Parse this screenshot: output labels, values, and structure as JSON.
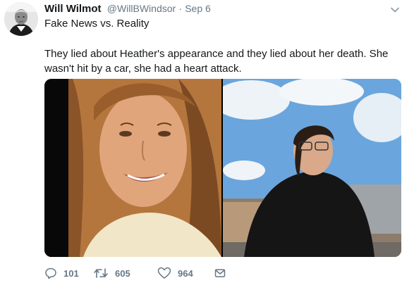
{
  "tweet": {
    "author_name": "Will Wilmot",
    "handle": "@WillBWindsor",
    "separator": "·",
    "time": "Sep 6",
    "line1": "Fake News vs. Reality",
    "text": "They lied about Heather's appearance and they lied about her death. She wasn't hit by a car, she had a heart attack."
  },
  "media": {
    "left_photo": "smiling woman portrait",
    "right_photo": "woman outdoors under cloudy sky"
  },
  "actions": {
    "reply_count": "101",
    "retweet_count": "605",
    "like_count": "964"
  },
  "icons": {
    "caret": "chevron-down-icon",
    "reply": "reply-icon",
    "retweet": "retweet-icon",
    "like": "heart-icon",
    "dm": "envelope-icon"
  },
  "colors": {
    "text": "#14171a",
    "secondary": "#657786"
  }
}
